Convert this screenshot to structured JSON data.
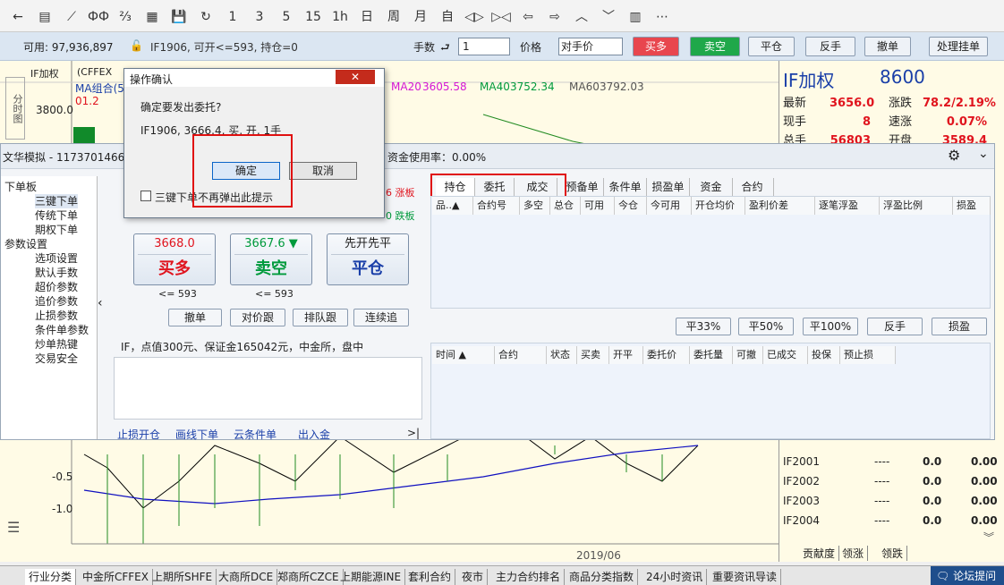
{
  "toolbar": {
    "icons": [
      "back-arrow-icon",
      "list-icon",
      "line-chart-icon",
      "split-icon",
      "formula-icon",
      "stats-icon",
      "save-icon",
      "refresh-icon",
      "1",
      "3",
      "5",
      "15",
      "1h",
      "日",
      "周",
      "月",
      "自",
      "expand-icon",
      "collapse-icon",
      "left-arrow-icon",
      "right-arrow-icon",
      "up-chevron-icon",
      "down-chevron-icon",
      "layout-icon",
      "more-icon"
    ],
    "labels": [
      "←",
      "▤",
      "⟋",
      "ФФ",
      "⅔",
      "▦",
      "💾",
      "↻",
      "1",
      "3",
      "5",
      "15",
      "1h",
      "日",
      "周",
      "月",
      "自",
      "◁▷",
      "▷◁",
      "⇦",
      "⇨",
      "︿",
      "﹀",
      "▥",
      "⋯"
    ]
  },
  "tradebar": {
    "available": "可用: 97,936,897",
    "contract_info": "IF1906, 可开<=593, 持仓=0",
    "qty_label": "手数",
    "qty_value": "1",
    "price_label": "价格",
    "price_value": "对手价",
    "buy": "买多",
    "sell": "卖空",
    "close": "平仓",
    "reverse": "反手",
    "cancel": "撤单",
    "pending": "处理挂单"
  },
  "chart": {
    "legend_name": "IF加权",
    "legend_code": "(CFFEX",
    "ma_combo": "MA组合(5",
    "ma_val": "01.2",
    "ma20": "MA20",
    "ma20_val": "3605.58",
    "ma40": "MA40",
    "ma40_val": "3752.34",
    "ma60": "MA60",
    "ma60_val": "3792.03",
    "axis_left": "分时图",
    "price_3800": "3800.0",
    "axis_m05": "-0.5",
    "axis_m10": "-1.0",
    "date": "2019/06"
  },
  "quote": {
    "title": "IF加权",
    "code": "8600",
    "rows": [
      {
        "l": "最新",
        "v": "3656.0",
        "l2": "涨跌",
        "v2": "78.2/2.19%"
      },
      {
        "l": "现手",
        "v": "8",
        "l2": "速涨",
        "v2": "0.07%"
      },
      {
        "l": "总手",
        "v": "56803",
        "l2": "开盘",
        "v2": "3589.4"
      }
    ],
    "list": [
      {
        "name": "IF2001",
        "a": "----",
        "b": "0.0",
        "c": "0.00"
      },
      {
        "name": "IF2002",
        "a": "----",
        "b": "0.0",
        "c": "0.00"
      },
      {
        "name": "IF2003",
        "a": "----",
        "b": "0.0",
        "c": "0.00"
      },
      {
        "name": "IF2004",
        "a": "----",
        "b": "0.0",
        "c": "0.00"
      }
    ],
    "tabs": [
      "贡献度",
      "领涨",
      "领跌"
    ]
  },
  "panel": {
    "account": "文华模拟 - 1173701466",
    "fund_rate": "资金使用率：0.00%",
    "tree": [
      {
        "t": "下单板",
        "lvl": 0
      },
      {
        "t": "三键下单",
        "lvl": 2
      },
      {
        "t": "传统下单",
        "lvl": 2
      },
      {
        "t": "期权下单",
        "lvl": 2
      },
      {
        "t": "参数设置",
        "lvl": 0
      },
      {
        "t": "选项设置",
        "lvl": 2
      },
      {
        "t": "默认手数",
        "lvl": 2
      },
      {
        "t": "超价参数",
        "lvl": 2
      },
      {
        "t": "追价参数",
        "lvl": 2
      },
      {
        "t": "止损参数",
        "lvl": 2
      },
      {
        "t": "条件单参数",
        "lvl": 2
      },
      {
        "t": "炒单热键",
        "lvl": 2
      },
      {
        "t": "交易安全",
        "lvl": 2
      }
    ],
    "limit_up": "6 涨板",
    "limit_down": "0 跌板",
    "buy_price": "3668.0",
    "buy_label": "买多",
    "sell_price": "3667.6 ▼",
    "sell_label": "卖空",
    "close_top": "先开先平",
    "close_label": "平仓",
    "buy_max": "<= 593",
    "sell_max": "<= 593",
    "btn_cancel": "撤单",
    "btn_match": "对价跟",
    "btn_queue": "排队跟",
    "btn_continue": "连续追",
    "info": "IF，点值300元、保证金165042元，中金所，盘中",
    "links": [
      "止损开仓",
      "画线下单",
      "云条件单",
      "出入金"
    ],
    "link_end": ">|",
    "tabs": [
      "持仓",
      "委托",
      "成交",
      "预备单",
      "条件单",
      "损盈单",
      "资金",
      "合约"
    ],
    "pos_cols": [
      "品..▲",
      "合约号",
      "多空",
      "总仓",
      "可用",
      "今仓",
      "今可用",
      "开仓均价",
      "盈利价差",
      "逐笔浮盈",
      "浮盈比例",
      "损盈"
    ],
    "pos_btns": [
      "平33%",
      "平50%",
      "平100%",
      "反手",
      "损盈"
    ],
    "ord_cols": [
      "时间 ▲",
      "合约",
      "状态",
      "买卖",
      "开平",
      "委托价",
      "委托量",
      "可撤",
      "已成交",
      "投保",
      "预止损"
    ]
  },
  "dialog": {
    "title": "操作确认",
    "question": "确定要发出委托?",
    "detail": "IF1906, 3666.4, 买, 开, 1手",
    "ok": "确定",
    "cancel": "取消",
    "checkbox": "三键下单不再弹出此提示"
  },
  "bottom": {
    "tabs": [
      "行业分类",
      "中金所CFFEX",
      "上期所SHFE",
      "大商所DCE",
      "郑商所CZCE",
      "上期能源INE",
      "套利合约",
      "夜市",
      "主力合约排名",
      "商品分类指数",
      "24小时资讯",
      "重要资讯导读"
    ],
    "forum": "论坛提问"
  },
  "colors": {
    "red": "#e0141e",
    "green": "#009a3c",
    "blue": "#1a3fa8",
    "highlight": "#e01010"
  }
}
